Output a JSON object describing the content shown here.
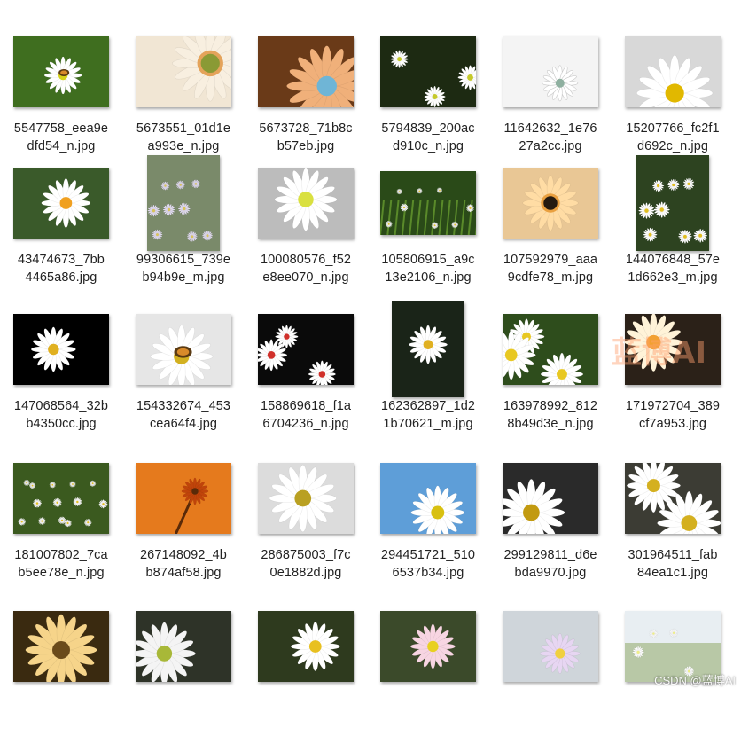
{
  "watermark": {
    "center_text": "蓝博AI",
    "corner_text": "CSDN @蓝博AI"
  },
  "files": [
    {
      "line1": "5547758_eea9e",
      "line2": "dfd54_n.jpg",
      "icon": "daisy-with-bee",
      "orient": "land"
    },
    {
      "line1": "5673551_01d1e",
      "line2": "a993e_n.jpg",
      "icon": "gerbera-closeup-cream",
      "orient": "land"
    },
    {
      "line1": "5673728_71b8c",
      "line2": "b57eb.jpg",
      "icon": "gerbera-orange-blue",
      "orient": "land"
    },
    {
      "line1": "5794839_200ac",
      "line2": "d910c_n.jpg",
      "icon": "daisies-dark",
      "orient": "land"
    },
    {
      "line1": "11642632_1e76",
      "line2": "27a2cc.jpg",
      "icon": "daisy-white-bg",
      "orient": "land"
    },
    {
      "line1": "15207766_fc2f1",
      "line2": "d692c_n.jpg",
      "icon": "daisy-closeup",
      "orient": "land"
    },
    {
      "line1": "43474673_7bb",
      "line2": "4465a86.jpg",
      "icon": "daisy-orange-center",
      "orient": "land"
    },
    {
      "line1": "99306615_739e",
      "line2": "b94b9e_m.jpg",
      "icon": "aster-cluster",
      "orient": "port"
    },
    {
      "line1": "100080576_f52",
      "line2": "e8ee070_n.jpg",
      "icon": "daisy-white-yellow",
      "orient": "land"
    },
    {
      "line1": "105806915_a9c",
      "line2": "13e2106_n.jpg",
      "icon": "meadow-daisies",
      "orient": "wide"
    },
    {
      "line1": "107592979_aaa",
      "line2": "9cdfe78_m.jpg",
      "icon": "gerbera-peach",
      "orient": "land"
    },
    {
      "line1": "144076848_57e",
      "line2": "1d662e3_m.jpg",
      "icon": "daisy-bunch",
      "orient": "port"
    },
    {
      "line1": "147068564_32b",
      "line2": "b4350cc.jpg",
      "icon": "daisy-black-bg",
      "orient": "land"
    },
    {
      "line1": "154332674_453",
      "line2": "cea64f4.jpg",
      "icon": "daisy-with-beetle",
      "orient": "land"
    },
    {
      "line1": "158869618_f1a",
      "line2": "6704236_n.jpg",
      "icon": "daisies-red-center",
      "orient": "land"
    },
    {
      "line1": "162362897_1d2",
      "line2": "1b70621_m.jpg",
      "icon": "daisy-stem-dark",
      "orient": "port"
    },
    {
      "line1": "163978992_812",
      "line2": "8b49d3e_n.jpg",
      "icon": "daisies-green-bg",
      "orient": "land"
    },
    {
      "line1": "171972704_389",
      "line2": "cf7a953.jpg",
      "icon": "daisy-yellowish",
      "orient": "land"
    },
    {
      "line1": "181007802_7ca",
      "line2": "b5ee78e_n.jpg",
      "icon": "daisy-field",
      "orient": "land"
    },
    {
      "line1": "267148092_4b",
      "line2": "b874af58.jpg",
      "icon": "silhouette-orange",
      "orient": "land"
    },
    {
      "line1": "286875003_f7c",
      "line2": "0e1882d.jpg",
      "icon": "daisy-bright",
      "orient": "land"
    },
    {
      "line1": "294451721_510",
      "line2": "6537b34.jpg",
      "icon": "daisy-blue-sky",
      "orient": "land"
    },
    {
      "line1": "299129811_d6e",
      "line2": "bda9970.jpg",
      "icon": "daisy-dew",
      "orient": "land"
    },
    {
      "line1": "301964511_fab",
      "line2": "84ea1c1.jpg",
      "icon": "daisy-two",
      "orient": "land"
    },
    {
      "line1": "",
      "line2": "",
      "icon": "daisy-yellow-petals",
      "orient": "land"
    },
    {
      "line1": "",
      "line2": "",
      "icon": "daisy-droplets",
      "orient": "land"
    },
    {
      "line1": "",
      "line2": "",
      "icon": "daisy-bees",
      "orient": "land"
    },
    {
      "line1": "",
      "line2": "",
      "icon": "daisy-pink-tips",
      "orient": "land"
    },
    {
      "line1": "",
      "line2": "",
      "icon": "daisy-pink-car",
      "orient": "land"
    },
    {
      "line1": "",
      "line2": "",
      "icon": "field-sky",
      "orient": "land"
    }
  ]
}
